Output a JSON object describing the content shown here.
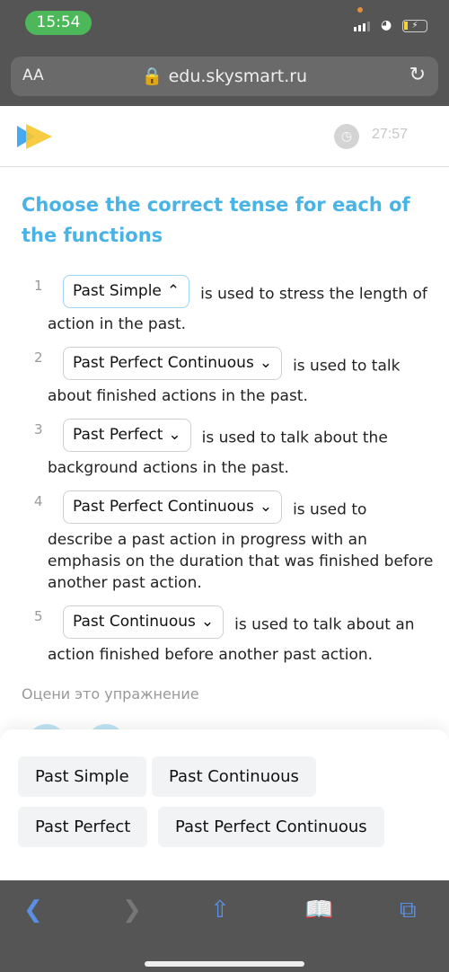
{
  "status": {
    "time": "15:54"
  },
  "browser": {
    "text_size": "AA",
    "url": "edu.skysmart.ru"
  },
  "header": {
    "timer": "27:57"
  },
  "exercise": {
    "title": "Choose the correct tense for each of the functions",
    "items": [
      {
        "num": "1",
        "selected": "Past Simple",
        "open": true,
        "text": "is used to stress the length of action in the past."
      },
      {
        "num": "2",
        "selected": "Past Perfect Continuous",
        "open": false,
        "text": "is used to talk about finished actions in the past."
      },
      {
        "num": "3",
        "selected": "Past Perfect",
        "open": false,
        "text": "is used to talk about the background actions in the past."
      },
      {
        "num": "4",
        "selected": "Past Perfect Continuous",
        "open": false,
        "text": "is used to describe a past action in progress with an emphasis on the duration that was finished before another past action."
      },
      {
        "num": "5",
        "selected": "Past Continuous",
        "open": false,
        "text": "is used to talk about an action finished before another past action."
      }
    ],
    "rate_label": "Оцени это упражнение"
  },
  "options": [
    "Past Simple",
    "Past Continuous",
    "Past Perfect",
    "Past Perfect Continuous"
  ],
  "colors": {
    "accent": "#4ab3e6",
    "toolbar_icons": "#5b8fe3",
    "status_time_bg": "#4cb85a"
  }
}
